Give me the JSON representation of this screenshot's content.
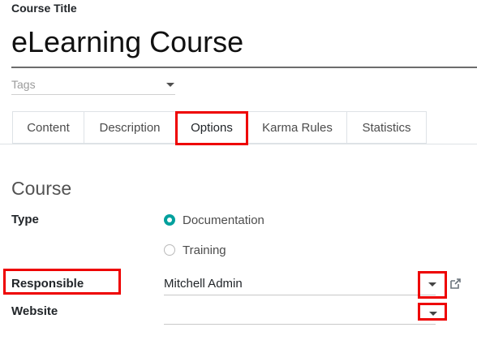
{
  "form": {
    "course_title_label": "Course Title",
    "course_name": "eLearning Course",
    "tags_placeholder": "Tags"
  },
  "tabs": [
    {
      "label": "Content"
    },
    {
      "label": "Description"
    },
    {
      "label": "Options",
      "active": true
    },
    {
      "label": "Karma Rules"
    },
    {
      "label": "Statistics"
    }
  ],
  "options": {
    "section_title": "Course",
    "type_label": "Type",
    "type_options": [
      {
        "label": "Documentation",
        "selected": true
      },
      {
        "label": "Training",
        "selected": false
      }
    ],
    "responsible_label": "Responsible",
    "responsible_value": "Mitchell Admin",
    "website_label": "Website",
    "website_value": ""
  },
  "icons": {
    "external_link": "external-link-icon",
    "dropdown": "caret-down-icon"
  },
  "colors": {
    "accent": "#00a09d",
    "highlight": "#ee0000"
  }
}
